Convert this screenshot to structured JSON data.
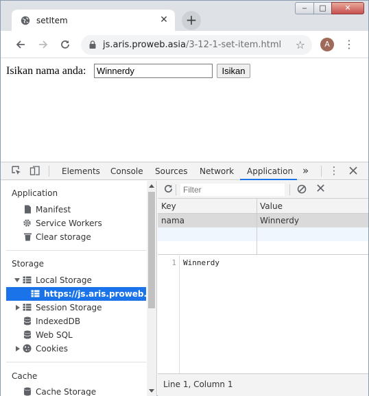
{
  "browser": {
    "tab_title": "setItem",
    "tab_close": "✕",
    "new_tab": "+",
    "url_domain": "js.aris.proweb.asia",
    "url_path": "/3-12-1-set-item.html",
    "avatar_letter": "A",
    "window_min": "‒",
    "window_max": "□",
    "window_close": "✕"
  },
  "page": {
    "label": "Isikan nama anda:",
    "input_value": "Winnerdy",
    "button_label": "Isikan"
  },
  "devtools": {
    "tabs": [
      "Elements",
      "Console",
      "Sources",
      "Network",
      "Application"
    ],
    "active_tab": "Application",
    "more_tabs": "»",
    "sidebar": {
      "section_application": "Application",
      "manifest": "Manifest",
      "service_workers": "Service Workers",
      "clear_storage": "Clear storage",
      "section_storage": "Storage",
      "local_storage": "Local Storage",
      "local_storage_origin": "https://js.aris.proweb.asia",
      "session_storage": "Session Storage",
      "indexeddb": "IndexedDB",
      "web_sql": "Web SQL",
      "cookies": "Cookies",
      "section_cache": "Cache",
      "cache_storage": "Cache Storage"
    },
    "filter_placeholder": "Filter",
    "table": {
      "columns": [
        "Key",
        "Value"
      ],
      "rows": [
        {
          "key": "nama",
          "value": "Winnerdy"
        }
      ]
    },
    "preview": {
      "line_number": "1",
      "content": "Winnerdy"
    },
    "status": "Line 1, Column 1"
  },
  "colors": {
    "accent": "#1a73e8",
    "titlebar": "#dee1e6",
    "selected_row": "#dadada"
  }
}
